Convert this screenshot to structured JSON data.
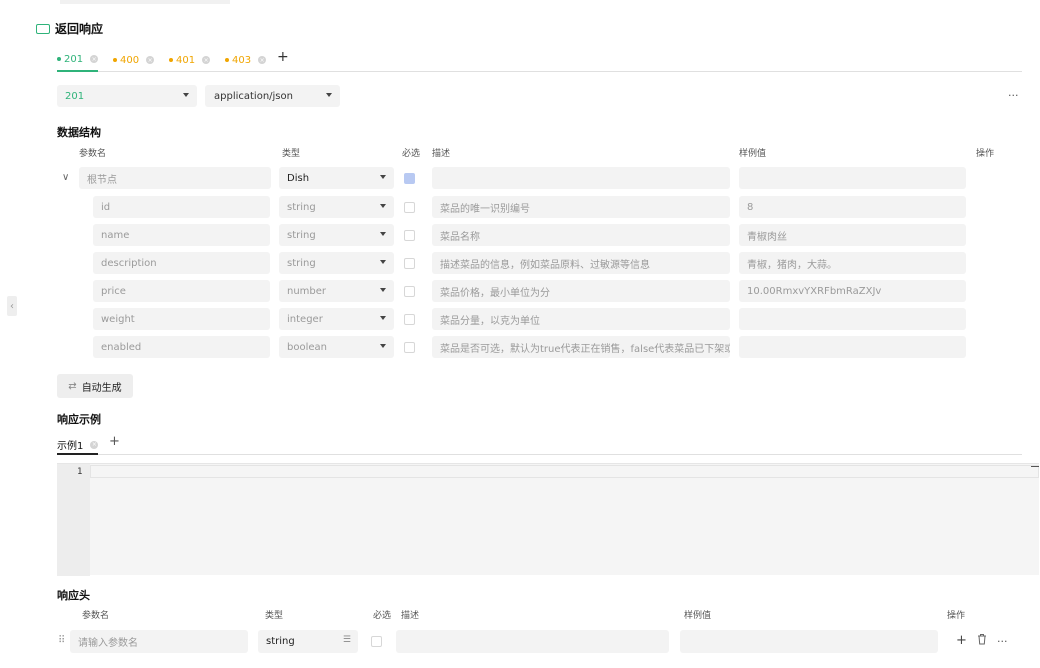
{
  "section": {
    "title": "返回响应"
  },
  "status_tabs": [
    {
      "label": "201",
      "color": "#2fb37a",
      "active": true
    },
    {
      "label": "400",
      "color": "#f0a500",
      "active": false
    },
    {
      "label": "401",
      "color": "#f0a500",
      "active": false
    },
    {
      "label": "403",
      "color": "#f0a500",
      "active": false
    }
  ],
  "status_select": {
    "value": "201"
  },
  "content_type_select": {
    "value": "application/json"
  },
  "data_structure": {
    "title": "数据结构",
    "headers": {
      "name": "参数名",
      "type": "类型",
      "required": "必选",
      "desc": "描述",
      "example": "样例值",
      "action": "操作"
    },
    "root": {
      "name": "根节点",
      "type": "Dish",
      "required": true
    },
    "rows": [
      {
        "name": "id",
        "type": "string",
        "desc": "菜品的唯一识别编号",
        "example": "8"
      },
      {
        "name": "name",
        "type": "string",
        "desc": "菜品名称",
        "example": "青椒肉丝"
      },
      {
        "name": "description",
        "type": "string",
        "desc": "描述菜品的信息，例如菜品原料、过敏源等信息",
        "example": "青椒，猪肉，大蒜。"
      },
      {
        "name": "price",
        "type": "number",
        "desc": "菜品价格，最小单位为分",
        "example": "10.00RmxvYXRFbmRaZXJv"
      },
      {
        "name": "weight",
        "type": "integer",
        "desc": "菜品分量，以克为单位",
        "example": ""
      },
      {
        "name": "enabled",
        "type": "boolean",
        "desc": "菜品是否可选，默认为true代表正在销售，false代表菜品已下架或售!",
        "example": ""
      }
    ]
  },
  "auto_generate": {
    "label": "自动生成"
  },
  "response_example": {
    "title": "响应示例",
    "tab": "示例1",
    "line_number": "1"
  },
  "response_headers": {
    "title": "响应头",
    "headers": {
      "name": "参数名",
      "type": "类型",
      "required": "必选",
      "desc": "描述",
      "example": "样例值",
      "action": "操作"
    },
    "row": {
      "name_placeholder": "请输入参数名",
      "type": "string"
    }
  },
  "more_glyph": "···",
  "colors": {
    "accent": "#2fb37a",
    "warning": "#f0a500",
    "checkbox_on": "#b8c9f2"
  }
}
